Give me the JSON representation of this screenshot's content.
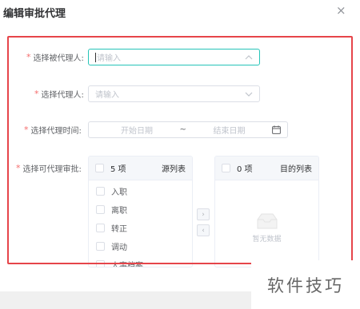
{
  "dialog": {
    "title": "编辑审批代理",
    "close_icon": "×"
  },
  "form": {
    "delegator": {
      "required": "*",
      "label": "选择被代理人:",
      "placeholder": "请输入"
    },
    "delegate": {
      "required": "*",
      "label": "选择代理人:",
      "placeholder": "请输入"
    },
    "period": {
      "required": "*",
      "label": "选择代理时间:",
      "start_placeholder": "开始日期",
      "separator": "~",
      "end_placeholder": "结束日期"
    },
    "approvals": {
      "required": "*",
      "label": "选择可代理审批:"
    }
  },
  "transfer": {
    "source": {
      "count": "5 项",
      "title": "源列表",
      "items": [
        "入职",
        "离职",
        "转正",
        "调动",
        "人事档案"
      ]
    },
    "target": {
      "count": "0 项",
      "title": "目的列表",
      "empty_text": "暂无数据"
    },
    "to_right": "›",
    "to_left": "‹"
  },
  "watermark": "软件技巧",
  "colors": {
    "required": "#f56c6c",
    "highlight": "#e6454a",
    "focus": "#26c4b8"
  }
}
